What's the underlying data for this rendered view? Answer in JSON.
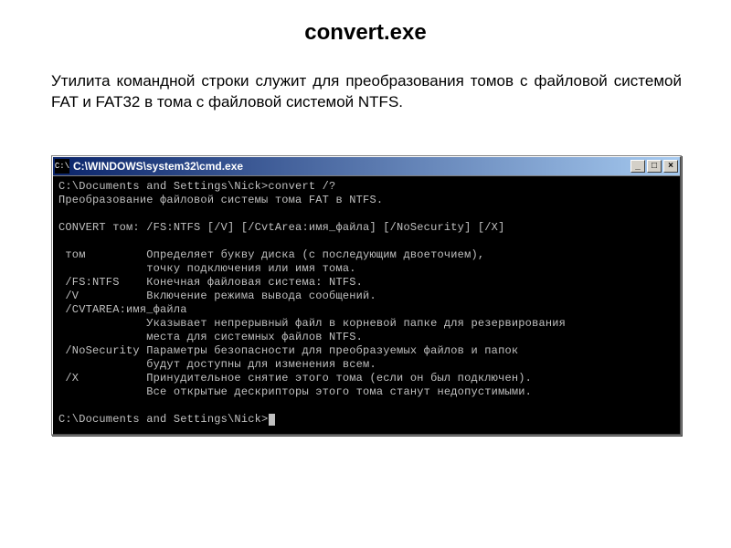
{
  "title": "convert.exe",
  "description": "Утилита командной строки служит для преобразования томов с файловой системой FAT и FAT32 в тома с файловой системой NTFS.",
  "window": {
    "icon_glyph": "C:\\",
    "caption": "C:\\WINDOWS\\system32\\cmd.exe",
    "btn_min": "_",
    "btn_max": "□",
    "btn_close": "×"
  },
  "terminal": {
    "l01": "C:\\Documents and Settings\\Nick>convert /?",
    "l02": "Преобразование файловой системы тома FAT в NTFS.",
    "l03": "",
    "l04": "CONVERT том: /FS:NTFS [/V] [/CvtArea:имя_файла] [/NoSecurity] [/X]",
    "l05": "",
    "l06": " том         Определяет букву диска (с последующим двоеточием),",
    "l07": "             точку подключения или имя тома.",
    "l08": " /FS:NTFS    Конечная файловая система: NTFS.",
    "l09": " /V          Включение режима вывода сообщений.",
    "l10": " /CVTAREA:имя_файла",
    "l11": "             Указывает непрерывный файл в корневой папке для резервирования",
    "l12": "             места для системных файлов NTFS.",
    "l13": " /NoSecurity Параметры безопасности для преобразуемых файлов и папок",
    "l14": "             будут доступны для изменения всем.",
    "l15": " /X          Принудительное снятие этого тома (если он был подключен).",
    "l16": "             Все открытые дескрипторы этого тома станут недопустимыми.",
    "l17": "",
    "l18": "C:\\Documents and Settings\\Nick>"
  }
}
